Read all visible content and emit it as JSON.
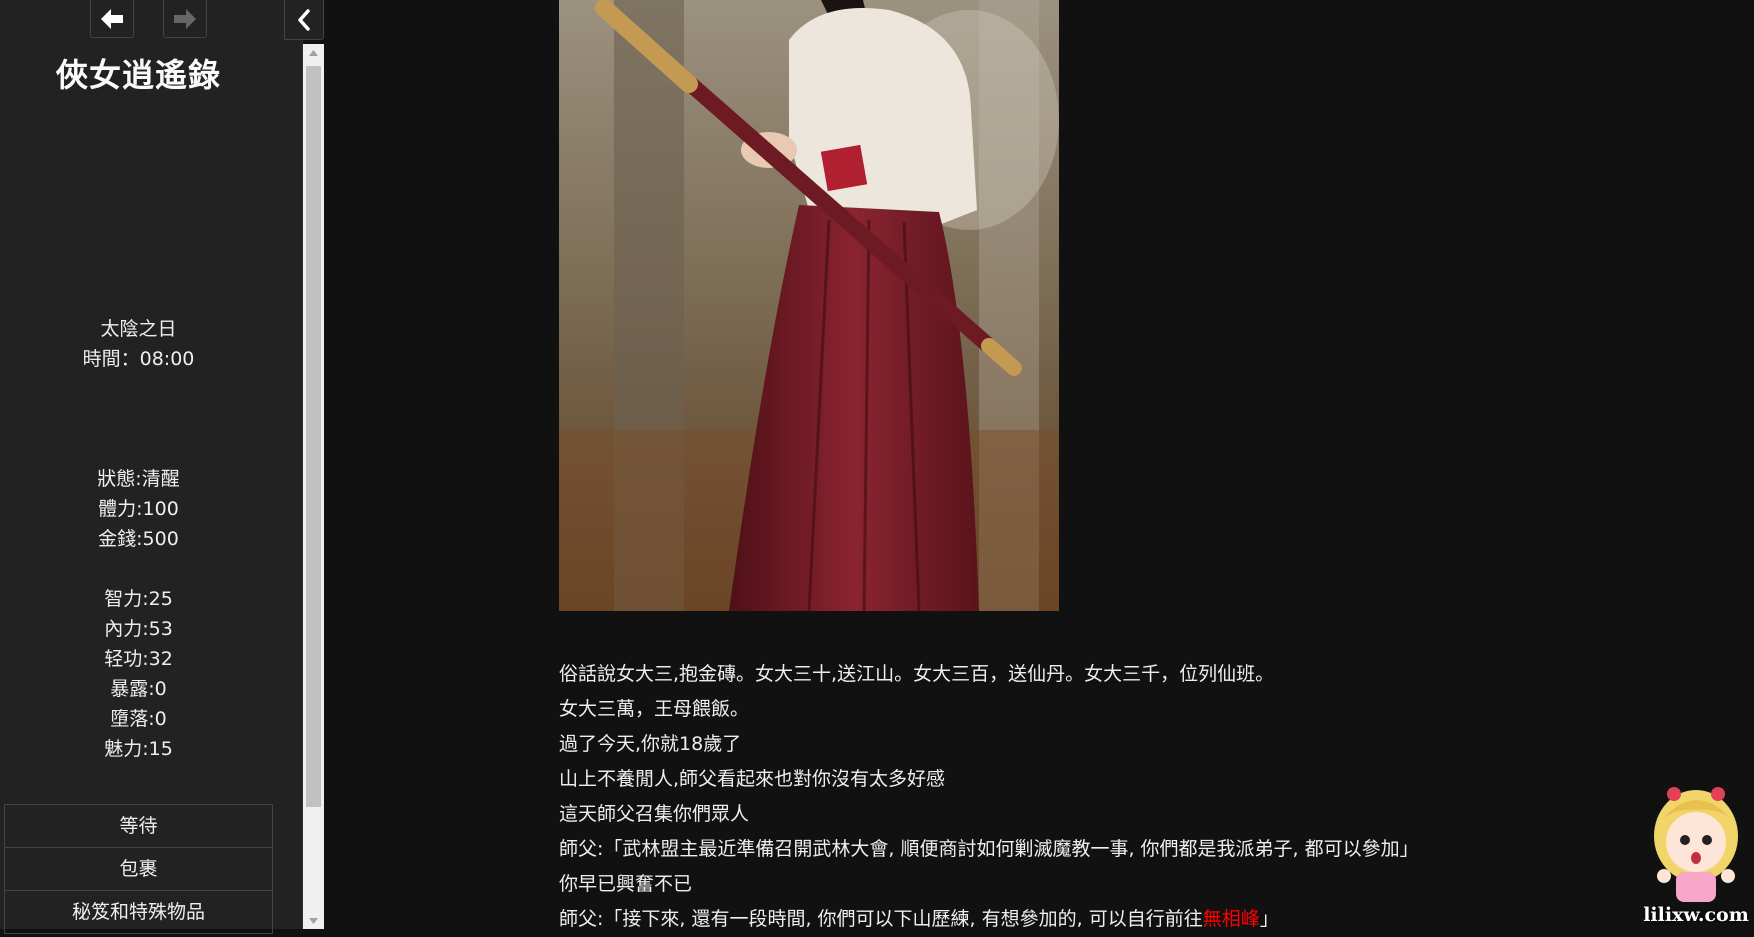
{
  "sidebar": {
    "title": "俠女逍遙錄",
    "history": {
      "back_icon": "arrow-left-icon",
      "forward_icon": "arrow-right-icon",
      "collapse_icon": "chevron-left-icon"
    },
    "date": {
      "day": "太陰之日",
      "time": "時間：08:00"
    },
    "stats": {
      "state": "狀態:清醒",
      "stamina": "體力:100",
      "money": "金錢:500"
    },
    "attributes": {
      "intelligence": "智力:25",
      "inner_power": "內力:53",
      "agility": "轻功:32",
      "exposure": "暴露:0",
      "corruption": "墮落:0",
      "charm": "魅力:15"
    },
    "menu": [
      "等待",
      "包裹",
      "秘笈和特殊物品"
    ]
  },
  "passage": {
    "image_alt": "swordswoman-in-hanfu-photo",
    "lines": [
      "俗話說女大三,抱金磚。女大三十,送江山。女大三百，送仙丹。女大三千，位列仙班。",
      "女大三萬，王母餵飯。",
      "過了今天,你就18歲了",
      "山上不養閒人,師父看起來也對你沒有太多好感",
      "這天師父召集你們眾人",
      "師父:「武林盟主最近準備召開武林大會, 順便商討如何剿滅魔教一事, 你們都是我派弟子, 都可以參加」",
      "你早已興奮不已"
    ],
    "last_line_prefix": "師父:「接下來, 還有一段時間, 你們可以下山歷練, 有想參加的, 可以自行前往",
    "last_line_link": "無相峰",
    "last_line_suffix": "」"
  },
  "watermark": {
    "text": "lilixw.com"
  },
  "colors": {
    "background": "#111111",
    "sidebar": "#222222",
    "text": "#eeeeee",
    "link": "#ff0000"
  }
}
